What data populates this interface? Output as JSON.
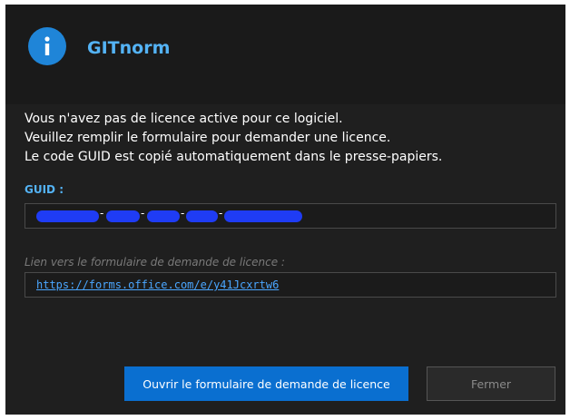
{
  "dialog": {
    "title": "GITnorm",
    "icon": "info-icon",
    "accent_color": "#1f85d8",
    "messages": [
      "Vous n'avez pas de licence active pour ce logiciel.",
      "Veuillez remplir le formulaire pour demander une licence.",
      "Le code GUID est copié automatiquement dans le presse-papiers."
    ],
    "guid": {
      "label": "GUID :",
      "separator": "-"
    },
    "link": {
      "label": "Lien vers le formulaire de demande de licence :",
      "url": "https://forms.office.com/e/y41Jcxrtw6"
    },
    "buttons": {
      "open_form": "Ouvrir le formulaire de demande de licence",
      "close": "Fermer"
    }
  }
}
